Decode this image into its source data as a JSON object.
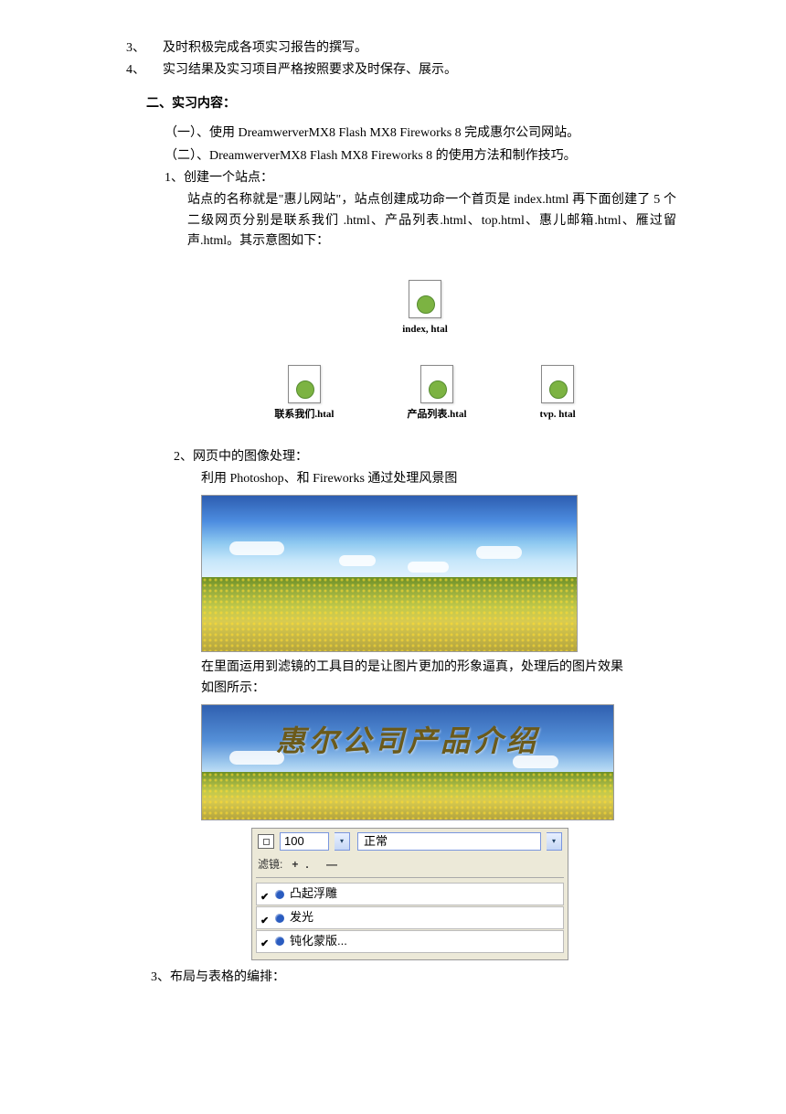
{
  "intro": {
    "items": [
      {
        "num": "3、",
        "text": "及时积极完成各项实习报告的撰写。"
      },
      {
        "num": "4、",
        "text": "实习结果及实习项目严格按照要求及时保存、展示。"
      }
    ]
  },
  "section_heading": "二、实习内容：",
  "subitems": {
    "one": "（一）、使用 DreamwerverMX8 Flash MX8 Fireworks 8 完成惠尔公司网站。",
    "two": "（二）、DreamwerverMX8 Flash MX8 Fireworks 8 的使用方法和制作技巧。",
    "s1_title": "1、创建一个站点：",
    "s1_body": "站点的名称就是\"惠儿网站\"，站点创建成功命一个首页是 index.html 再下面创建了 5 个二级网页分别是联系我们      .html、产品列表.html、top.html、惠儿邮箱.html、雁过留声.html。其示意图如下：",
    "s2_title": "2、网页中的图像处理：",
    "s2_body": "利用 Photoshop、和 Fireworks 通过处理风景图",
    "s2_mid": "在里面运用到滤镜的工具目的是让图片更加的形象逼真，处理后的图片效果如图所示：",
    "s3_title": "3、布局与表格的编排："
  },
  "file_icons": {
    "single": "index, htal",
    "row": [
      "联系我们.htal",
      "产品列表.htal",
      "tvp. htal"
    ]
  },
  "banner_text": "惠尔公司产品介绍",
  "filter_panel": {
    "value": "100",
    "mode": "正常",
    "label": "滤镜:",
    "pm": "+. —",
    "items": [
      "凸起浮雕",
      "发光",
      "钝化蒙版..."
    ]
  }
}
